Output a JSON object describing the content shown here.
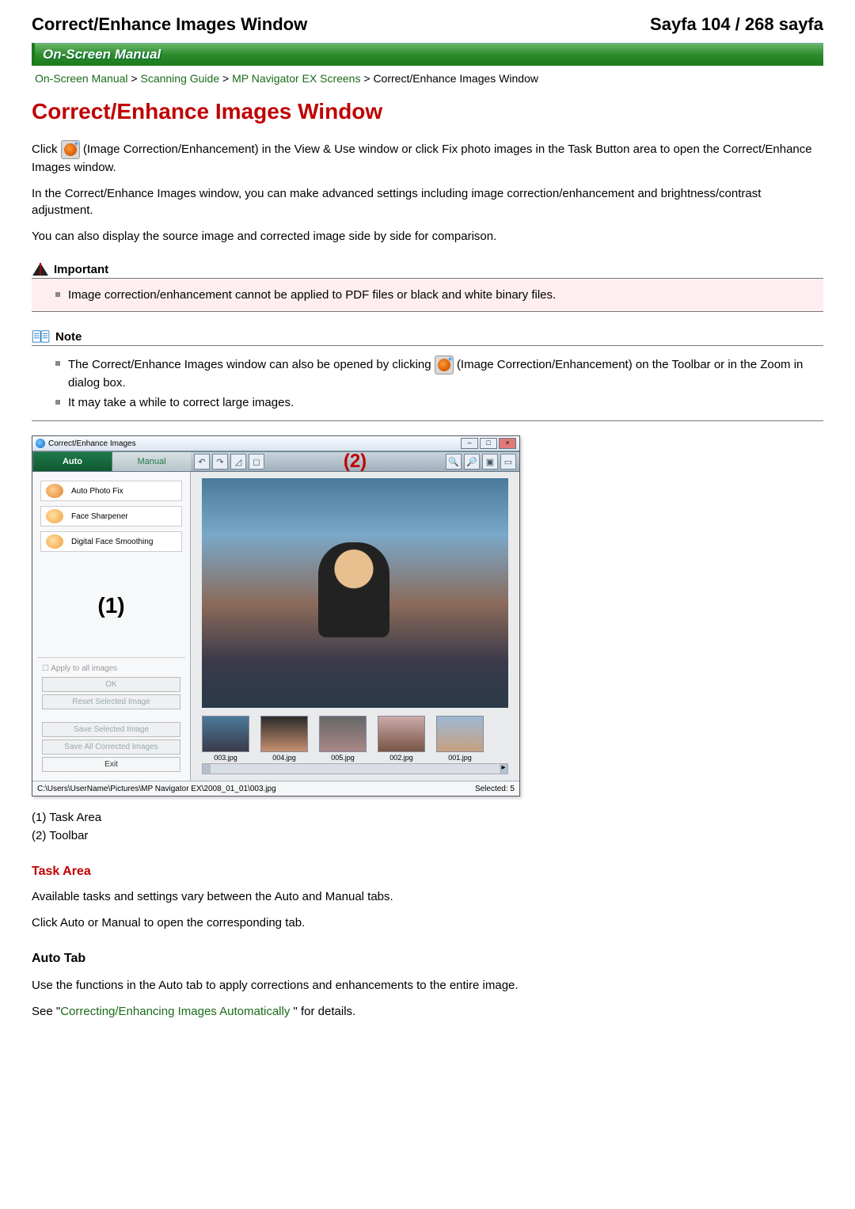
{
  "header": {
    "left": "Correct/Enhance Images Window",
    "right": "Sayfa 104 / 268 sayfa"
  },
  "manual_bar": "On-Screen Manual",
  "breadcrumb": {
    "items": [
      "On-Screen Manual",
      "Scanning Guide",
      "MP Navigator EX Screens"
    ],
    "sep": " > ",
    "current": "Correct/Enhance Images Window"
  },
  "title": "Correct/Enhance Images Window",
  "intro": {
    "click": "Click ",
    "after_icon": " (Image Correction/Enhancement) in the View & Use window or click Fix photo images in the Task Button area to open the Correct/Enhance Images window.",
    "p2": "In the Correct/Enhance Images window, you can make advanced settings including image correction/enhancement and brightness/contrast adjustment.",
    "p3": "You can also display the source image and corrected image side by side for comparison."
  },
  "important": {
    "label": "Important",
    "items": [
      "Image correction/enhancement cannot be applied to PDF files or black and white binary files."
    ]
  },
  "note": {
    "label": "Note",
    "items": [
      {
        "pre": "The Correct/Enhance Images window can also be opened by clicking ",
        "post": " (Image Correction/Enhancement) on the Toolbar or in the Zoom in dialog box."
      },
      {
        "text": "It may take a while to correct large images."
      }
    ]
  },
  "app": {
    "title": "Correct/Enhance Images",
    "tabs": {
      "active": "Auto",
      "inactive": "Manual"
    },
    "task_buttons": [
      "Auto Photo Fix",
      "Face Sharpener",
      "Digital Face Smoothing"
    ],
    "callout_task": "(1)",
    "callout_toolbar": "(2)",
    "apply_all": "Apply to all images",
    "ok": "OK",
    "reset": "Reset Selected Image",
    "save_selected": "Save Selected Image",
    "save_all": "Save All Corrected Images",
    "exit": "Exit",
    "thumbs": [
      "003.jpg",
      "004.jpg",
      "005.jpg",
      "002.jpg",
      "001.jpg"
    ],
    "status_path": "C:\\Users\\UserName\\Pictures\\MP Navigator EX\\2008_01_01\\003.jpg",
    "status_selected": "Selected: 5"
  },
  "legend": {
    "l1": "(1) Task Area",
    "l2": "(2) Toolbar"
  },
  "task_area": {
    "heading": "Task Area",
    "p1": "Available tasks and settings vary between the Auto and Manual tabs.",
    "p2": "Click Auto or Manual to open the corresponding tab."
  },
  "auto_tab": {
    "heading": "Auto Tab",
    "p1": "Use the functions in the Auto tab to apply corrections and enhancements to the entire image.",
    "see_pre": "See \"",
    "see_link": "Correcting/Enhancing Images Automatically",
    "see_post": " \" for details."
  }
}
